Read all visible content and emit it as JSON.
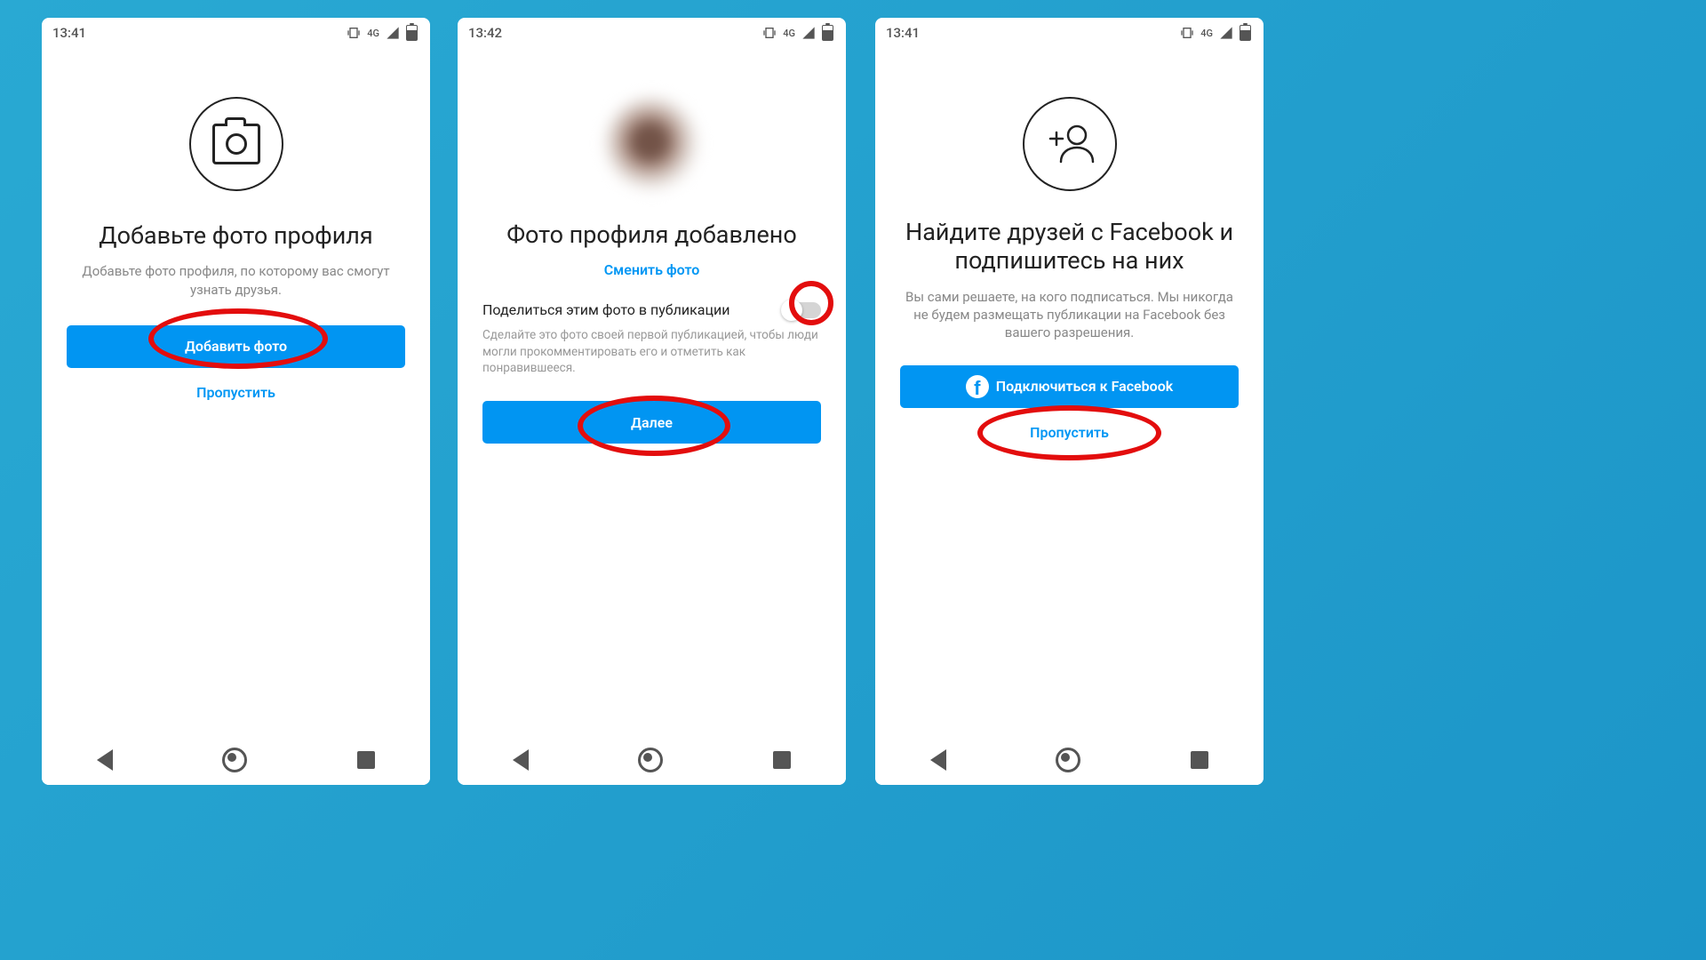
{
  "screens": {
    "s1": {
      "time": "13:41",
      "network_label": "4G",
      "title": "Добавьте фото профиля",
      "subtitle": "Добавьте фото профиля, по которому вас смогут узнать друзья.",
      "primary_button": "Добавить фото",
      "skip": "Пропустить"
    },
    "s2": {
      "time": "13:42",
      "network_label": "4G",
      "title": "Фото профиля добавлено",
      "change_photo": "Сменить фото",
      "share_label": "Поделиться этим фото в публикации",
      "share_hint": "Сделайте это фото своей первой публикацией, чтобы люди могли прокомментировать его и отметить как понравившееся.",
      "primary_button": "Далее",
      "toggle_on": false
    },
    "s3": {
      "time": "13:41",
      "network_label": "4G",
      "title": "Найдите друзей с Facebook и подпишитесь на них",
      "subtitle": "Вы сами решаете, на кого подписаться. Мы никогда не будем размещать публикации на Facebook без вашего разрешения.",
      "primary_button": "Подключиться к Facebook",
      "skip": "Пропустить"
    }
  }
}
